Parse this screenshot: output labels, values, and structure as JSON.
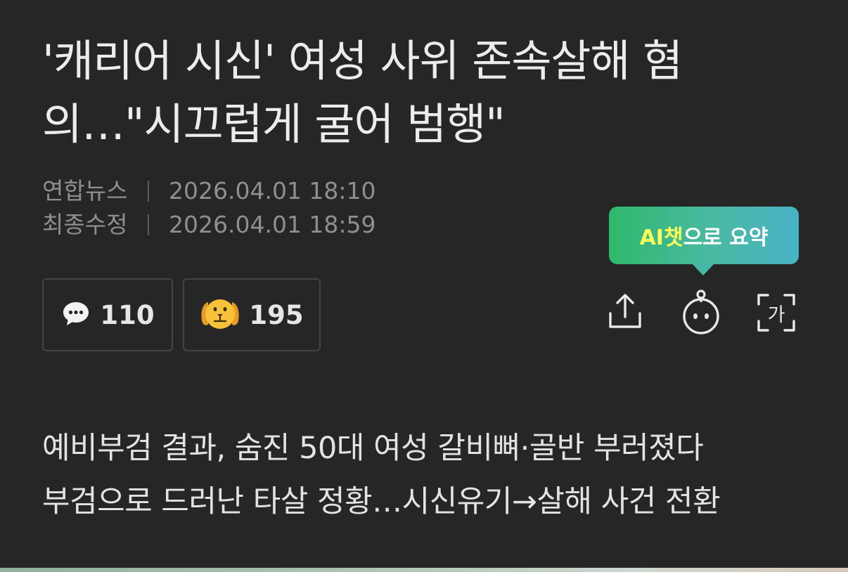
{
  "article": {
    "title_line1": "'캐리어 시신' 여성 사위 존속살해 혐",
    "title_line2": "의…\"시끄럽게 굴어 범행\"",
    "source_label": "연합뉴스",
    "published": "2026.04.01 18:10",
    "modified_label": "최종수정",
    "modified": "2026.04.01 18:59",
    "subheadline1": "예비부검 결과, 숨진 50대 여성 갈비뼈·골반 부러졌다",
    "subheadline2": "부검으로 드러난 타살 정황…시신유기→살해 사건 전환"
  },
  "counters": {
    "comments": "110",
    "reactions": "195"
  },
  "tooltip": {
    "highlight": "AI챗",
    "rest": "으로 요약"
  },
  "tools": {
    "share_icon": "share-icon",
    "bot_icon": "ai-bot-icon",
    "font_icon": "font-size-icon",
    "font_glyph": "가"
  },
  "colors": {
    "background": "#262626",
    "tooltip_gradient_start": "#2fb86b",
    "tooltip_gradient_end": "#49b3c6",
    "tooltip_highlight": "#f8ff5a"
  }
}
